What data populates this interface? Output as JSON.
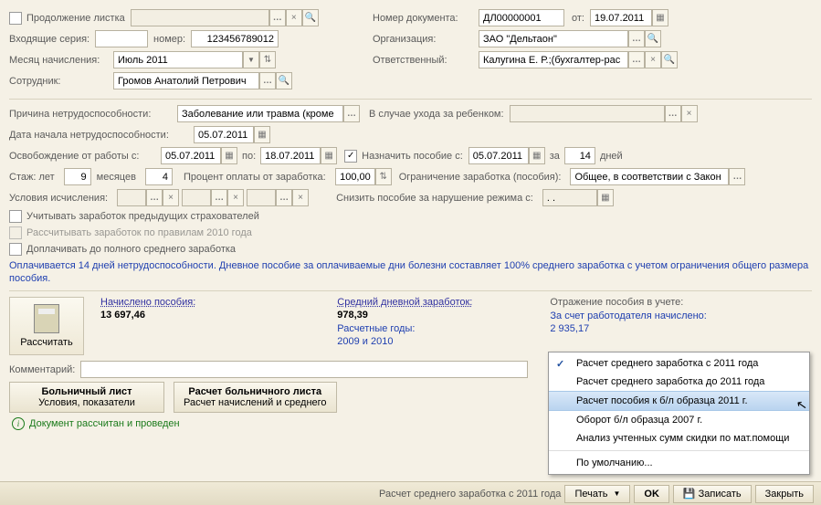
{
  "header": {
    "continuation_label": "Продолжение листка",
    "incoming_series_label": "Входящие серия:",
    "number_label": "номер:",
    "number": "123456789012",
    "accrual_month_label": "Месяц начисления:",
    "accrual_month": "Июль 2011",
    "employee_label": "Сотрудник:",
    "employee": "Громов Анатолий Петрович",
    "doc_num_label": "Номер документа:",
    "doc_num": "ДЛ00000001",
    "date_from_label": "от:",
    "date_from": "19.07.2011",
    "org_label": "Организация:",
    "org": "ЗАО \"Дельтаон\"",
    "resp_label": "Ответственный:",
    "resp": "Калугина Е. Р.;(бухгалтер-рас"
  },
  "cause": {
    "reason_label": "Причина нетрудоспособности:",
    "reason": "Заболевание или травма (кроме",
    "childcare_label": "В случае ухода за ребенком:",
    "start_label": "Дата начала нетрудоспособности:",
    "start": "05.07.2011",
    "release_label": "Освобождение от работы с:",
    "release_from": "05.07.2011",
    "to_label": "по:",
    "release_to": "18.07.2011",
    "assign_label": "Назначить пособие с:",
    "assign_from": "05.07.2011",
    "for_label": "за",
    "days": "14",
    "days_label": "дней",
    "seniority_label": "Стаж: лет",
    "years": "9",
    "months_label": "месяцев",
    "months": "4",
    "pay_pct_label": "Процент оплаты от заработка:",
    "pay_pct": "100,00",
    "limit_label": "Ограничение заработка (пособия):",
    "limit": "Общее, в соответствии с Закон",
    "calc_cond_label": "Условия исчисления:",
    "reduce_label": "Снизить пособие за нарушение режима с:",
    "reduce_date": " .  .    ",
    "cb1": "Учитывать заработок предыдущих страхователей",
    "cb2": "Рассчитывать заработок по правилам 2010 года",
    "cb3": "Доплачивать до полного среднего заработка"
  },
  "summary": "Оплачивается 14 дней нетрудоспособности. Дневное пособие за оплачиваемые дни болезни составляет 100% среднего заработка с учетом ограничения общего размера пособия.",
  "results": {
    "calc_btn": "Рассчитать",
    "accrued_label": "Начислено пособия:",
    "accrued": "13 697,46",
    "avg_label": "Средний дневной заработок:",
    "avg": "978,39",
    "years_label": "Расчетные годы:",
    "years": "2009 и 2010",
    "reflect_label": "Отражение пособия в учете:",
    "employer_label": "За счет работодателя начислено:",
    "employer_val": "2 935,17"
  },
  "comment_label": "Комментарий:",
  "tabs": {
    "t1_title": "Больничный лист",
    "t1_sub": "Условия, показатели",
    "t2_title": "Расчет больничного листа",
    "t2_sub": "Расчет начислений и среднего"
  },
  "doc_status": "Документ рассчитан и проведен",
  "menu": {
    "m1": "Расчет среднего заработка с 2011 года",
    "m2": "Расчет среднего заработка до 2011 года",
    "m3": "Расчет пособия к б/л образца 2011 г.",
    "m4": "Оборот б/л образца 2007 г.",
    "m5": "Анализ учтенных сумм скидки по мат.помощи",
    "m6": "По умолчанию..."
  },
  "footer": {
    "default": "Расчет среднего заработка с 2011 года",
    "print": "Печать",
    "ok": "OK",
    "save": "Записать",
    "close": "Закрыть"
  }
}
